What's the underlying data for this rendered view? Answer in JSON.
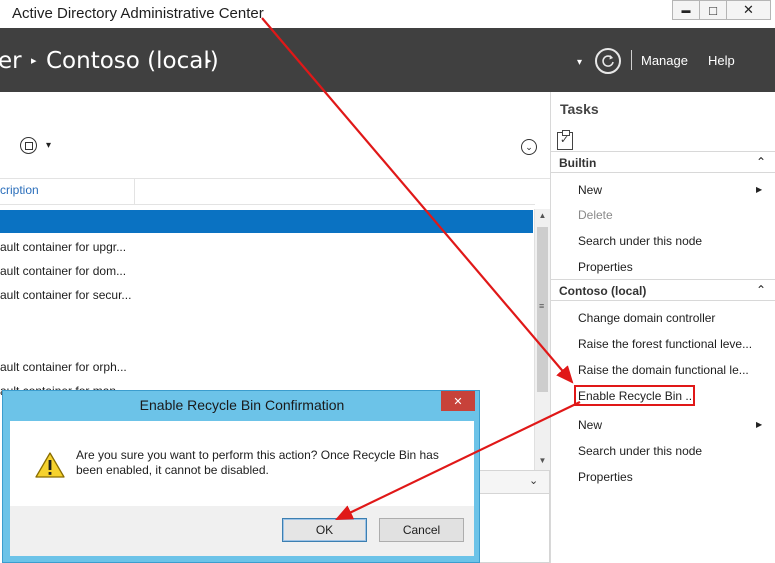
{
  "window": {
    "title": "Active Directory Administrative Center",
    "controls": {
      "minimize": "▬",
      "maximize": "□",
      "close": "✕"
    }
  },
  "header": {
    "breadcrumb_left": "er",
    "breadcrumb_main": "Contoso (local)",
    "separator": "▸",
    "dropdown": "▾",
    "manage": "Manage",
    "help": "Help",
    "refresh_icon": "refresh-icon"
  },
  "main": {
    "toolbar_caret": "▾",
    "column_header": "cription",
    "rows": [
      "ault container for upgr...",
      "ault container for dom...",
      "ault container for secur...",
      "ault container for orph...",
      "ault container for man"
    ],
    "expand_icon": "⌄"
  },
  "tasks": {
    "title": "Tasks",
    "sections": [
      {
        "label": "Builtin",
        "items": [
          {
            "label": "New",
            "submenu": true,
            "disabled": false
          },
          {
            "label": "Delete",
            "submenu": false,
            "disabled": true
          },
          {
            "label": "Search under this node",
            "submenu": false,
            "disabled": false
          },
          {
            "label": "Properties",
            "submenu": false,
            "disabled": false
          }
        ]
      },
      {
        "label": "Contoso (local)",
        "items": [
          {
            "label": "Change domain controller",
            "submenu": false,
            "disabled": false
          },
          {
            "label": "Raise the forest functional leve...",
            "submenu": false,
            "disabled": false
          },
          {
            "label": "Raise the domain functional le...",
            "submenu": false,
            "disabled": false
          },
          {
            "label": "Enable Recycle Bin ...",
            "submenu": false,
            "disabled": false
          },
          {
            "label": "New",
            "submenu": true,
            "disabled": false
          },
          {
            "label": "Search under this node",
            "submenu": false,
            "disabled": false
          },
          {
            "label": "Properties",
            "submenu": false,
            "disabled": false
          }
        ]
      }
    ]
  },
  "dialog": {
    "title": "Enable Recycle Bin Confirmation",
    "message": "Are you sure you want to perform this action? Once Recycle Bin has been enabled, it cannot be disabled.",
    "ok": "OK",
    "cancel": "Cancel",
    "close": "✕",
    "icon": "warning-icon"
  },
  "colors": {
    "header_bg": "#404040",
    "selection": "#0a72c2",
    "dialog_frame": "#6cc3e8",
    "annotation_red": "#e01818",
    "dialog_close": "#c7423a"
  }
}
